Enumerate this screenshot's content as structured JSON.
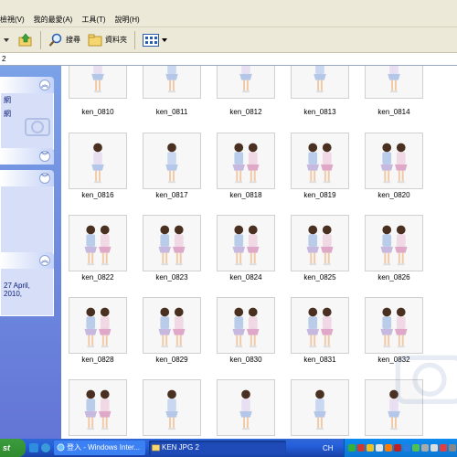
{
  "menu": {
    "items": [
      "檢視(V)",
      "我的最愛(A)",
      "工具(T)",
      "說明(H)"
    ]
  },
  "toolbar": {
    "search_label": "搜尋",
    "folders_label": "資料夾"
  },
  "address": {
    "value": "2"
  },
  "left": {
    "panel1_line1": "網",
    "panel1_line2": "網",
    "panel4_text": "27 April, 2010,"
  },
  "files": {
    "row1": [
      "ken_0810",
      "ken_0811",
      "ken_0812",
      "ken_0813",
      "ken_0814"
    ],
    "row2": [
      "ken_0816",
      "ken_0817",
      "ken_0818",
      "ken_0819",
      "ken_0820"
    ],
    "row3": [
      "ken_0822",
      "ken_0823",
      "ken_0824",
      "ken_0825",
      "ken_0826"
    ],
    "row4": [
      "ken_0828",
      "ken_0829",
      "ken_0830",
      "ken_0831",
      "ken_0832"
    ]
  },
  "taskbar": {
    "task1": "登入 - Windows Inter...",
    "task2": "KEN JPG 2",
    "lang": "CH"
  }
}
